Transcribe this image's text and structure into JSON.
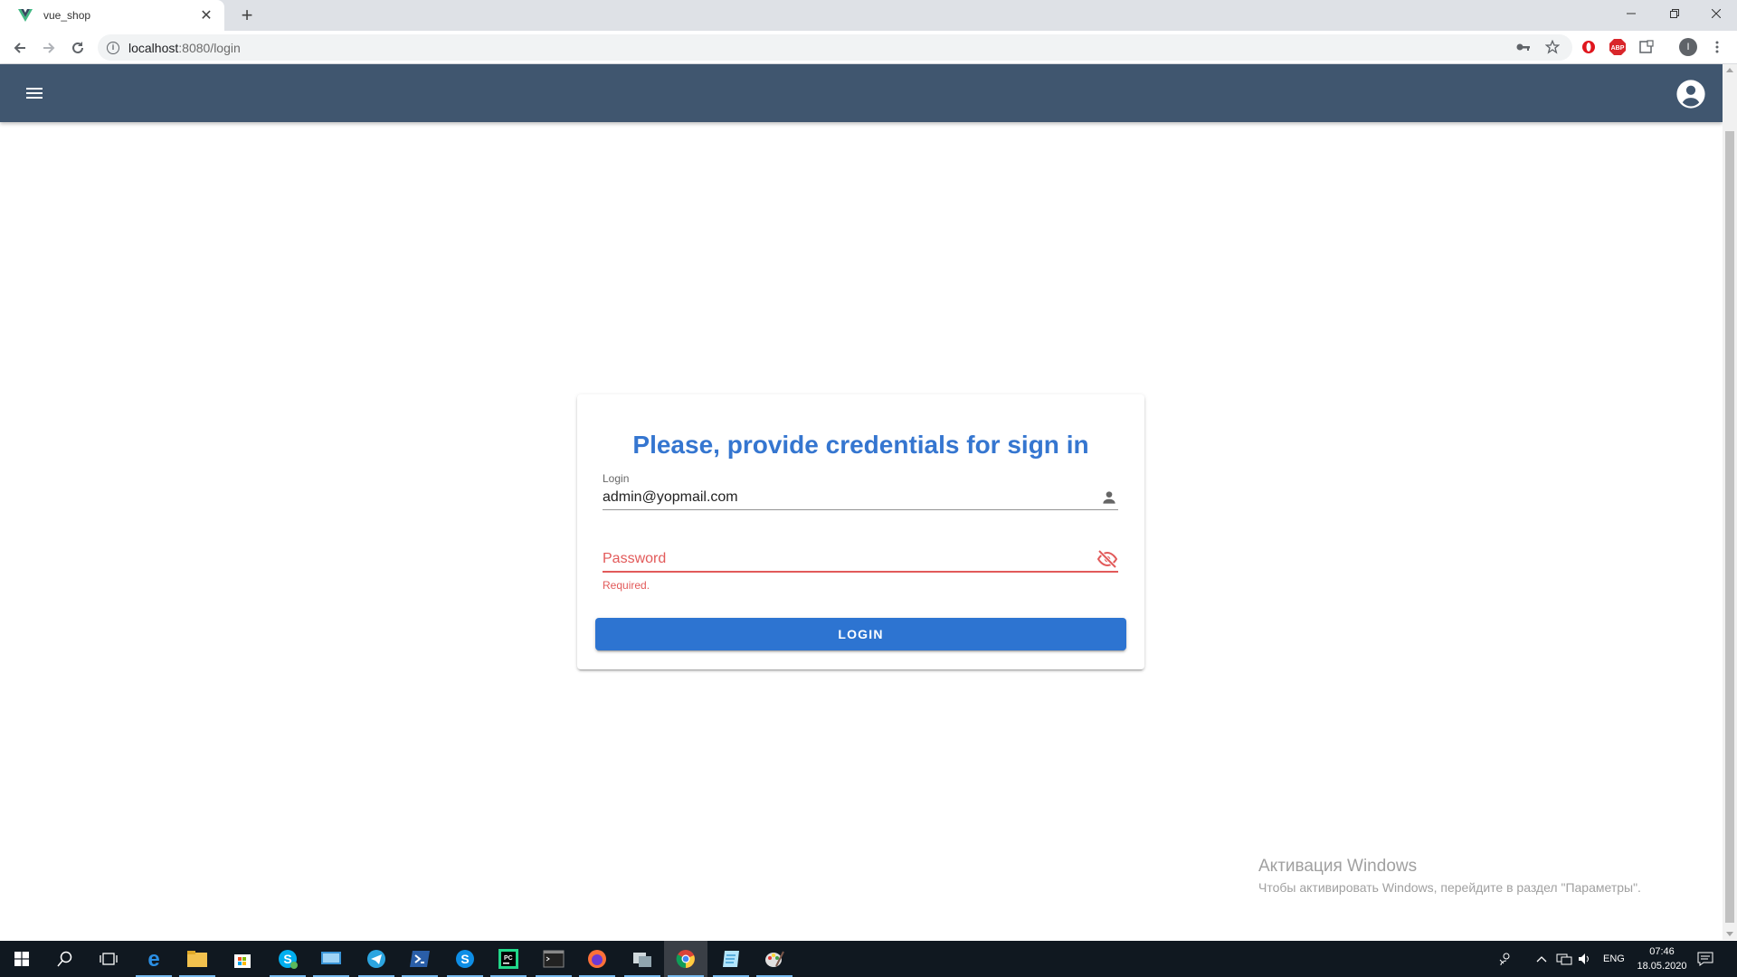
{
  "browser": {
    "tab_title": "vue_shop",
    "url_host": "localhost",
    "url_rest": ":8080/login",
    "profile_initial": "I"
  },
  "app": {
    "colors": {
      "appbar": "#40566f",
      "primary": "#3576d0",
      "error": "#e25a5a"
    }
  },
  "login_card": {
    "title": "Please, provide credentials for sign in",
    "login_label": "Login",
    "login_value": "admin@yopmail.com",
    "password_placeholder": "Password",
    "password_error": "Required.",
    "login_button": "LOGIN"
  },
  "watermark": {
    "line1": "Активация Windows",
    "line2": "Чтобы активировать Windows, перейдите в раздел \"Параметры\"."
  },
  "taskbar": {
    "language": "ENG",
    "time": "07:46",
    "date": "18.05.2020"
  }
}
